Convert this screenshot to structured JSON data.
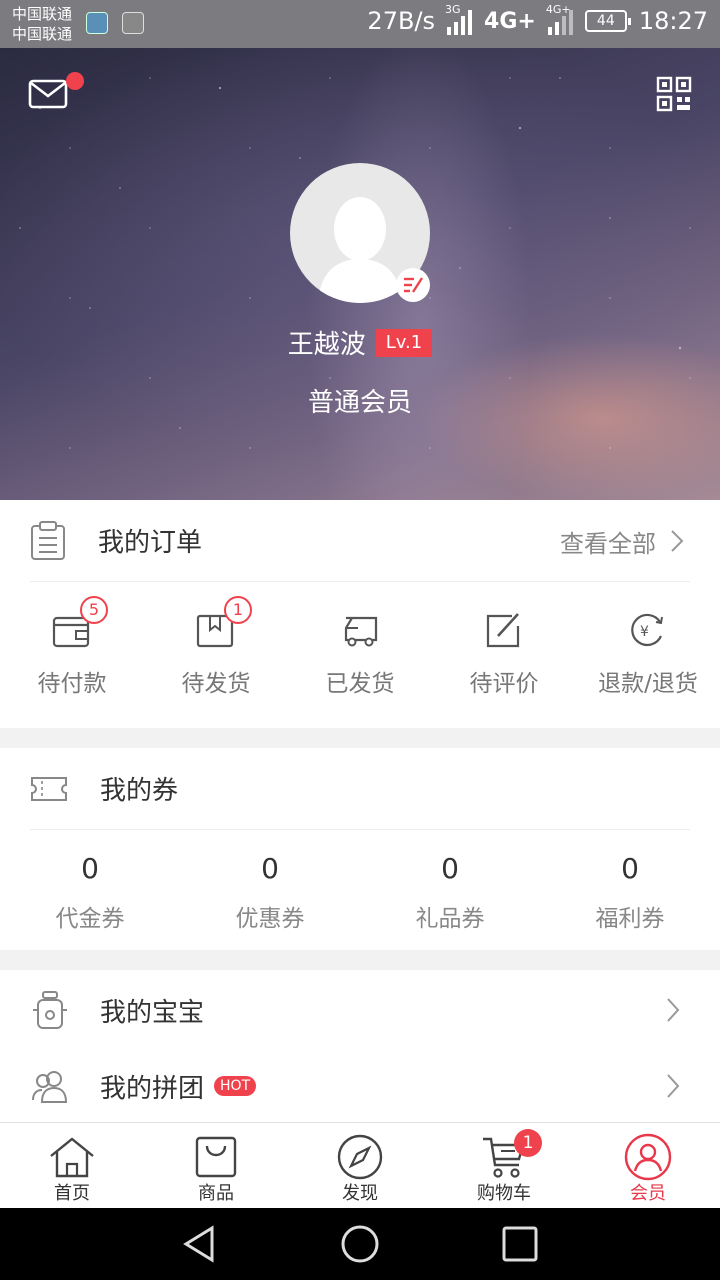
{
  "status_bar": {
    "carrier_1": "中国联通",
    "carrier_2": "中国联通",
    "speed": "27B/s",
    "net_3g": "3G",
    "net_4g": "4G+",
    "net_4g_small": "4G+",
    "battery": "44",
    "time": "18:27"
  },
  "profile": {
    "name": "王越波",
    "level_badge": "Lv.1",
    "member_level": "普通会员",
    "mail_has_unread": true
  },
  "orders": {
    "title": "我的订单",
    "view_all": "查看全部",
    "items": [
      {
        "label": "待付款",
        "badge": "5",
        "icon": "wallet-icon"
      },
      {
        "label": "待发货",
        "badge": "1",
        "icon": "package-icon"
      },
      {
        "label": "已发货",
        "badge": "",
        "icon": "truck-icon"
      },
      {
        "label": "待评价",
        "badge": "",
        "icon": "edit-review-icon"
      },
      {
        "label": "退款/退货",
        "badge": "",
        "icon": "refund-icon"
      }
    ]
  },
  "coupons": {
    "title": "我的券",
    "items": [
      {
        "count": "0",
        "label": "代金券"
      },
      {
        "count": "0",
        "label": "优惠券"
      },
      {
        "count": "0",
        "label": "礼品券"
      },
      {
        "count": "0",
        "label": "福利券"
      }
    ]
  },
  "menu": {
    "baby": "我的宝宝",
    "group": "我的拼团",
    "group_tag": "HOT"
  },
  "tabbar": {
    "items": [
      {
        "label": "首页",
        "icon": "home-icon"
      },
      {
        "label": "商品",
        "icon": "shopping-bag-icon"
      },
      {
        "label": "发现",
        "icon": "compass-icon"
      },
      {
        "label": "购物车",
        "icon": "cart-icon",
        "badge": "1"
      },
      {
        "label": "会员",
        "icon": "member-icon",
        "active": true
      }
    ]
  },
  "colors": {
    "accent": "#f0424c",
    "active_tab": "#e8384a"
  }
}
